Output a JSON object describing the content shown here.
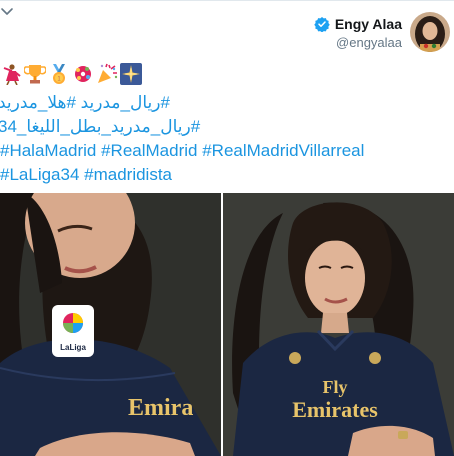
{
  "author": {
    "display_name": "Engy Alaa",
    "handle": "@engyalaa"
  },
  "emojis": [
    "dancer",
    "trophy",
    "medal",
    "sparkler",
    "party-popper",
    "sparkles"
  ],
  "text": {
    "line1": "#ريال_مدريد #هلا_مدريد",
    "line2": "#ريال_مدريد_بطل_الليغا_34",
    "line3": "#HalaMadrid #RealMadrid #RealMadridVillarreal",
    "line4": "#LaLiga34 #madridista"
  },
  "photos": {
    "left": {
      "sleeve_badge": "LaLiga",
      "shirt_text": "Emira"
    },
    "right": {
      "shirt_text_1": "Fly",
      "shirt_text_2": "Emirates"
    }
  },
  "colors": {
    "link": "#1b95e0",
    "verified": "#1da1f2",
    "name": "#14171a",
    "handle": "#657786"
  }
}
